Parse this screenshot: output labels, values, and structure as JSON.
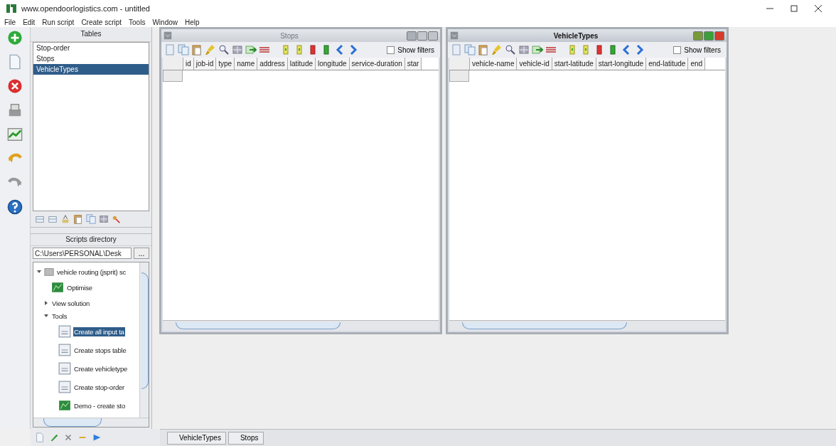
{
  "window": {
    "title": "www.opendoorlogistics.com - untitled"
  },
  "menu": [
    "File",
    "Edit",
    "Run script",
    "Create script",
    "Tools",
    "Window",
    "Help"
  ],
  "tables_panel": {
    "title": "Tables",
    "items": [
      {
        "label": "Stop-order",
        "selected": false
      },
      {
        "label": "Stops",
        "selected": false
      },
      {
        "label": "VehicleTypes",
        "selected": true
      }
    ]
  },
  "scripts_panel": {
    "title": "Scripts directory",
    "path": "C:\\Users\\PERSONAL\\Desk",
    "browse_button": "...",
    "tree": [
      {
        "label": "vehicle routing (jsprit) sc",
        "kind": "folder",
        "expanded": true,
        "selected": false,
        "children": [
          {
            "label": "Optimise",
            "kind": "script",
            "selected": false
          },
          {
            "label": "View solution",
            "kind": "group",
            "expanded": false,
            "selected": false
          },
          {
            "label": "Tools",
            "kind": "group",
            "expanded": true,
            "selected": false,
            "children": [
              {
                "label": "Create all input ta",
                "kind": "tool",
                "selected": true
              },
              {
                "label": "Create stops table",
                "kind": "tool",
                "selected": false
              },
              {
                "label": "Create vehicletype",
                "kind": "tool",
                "selected": false
              },
              {
                "label": "Create stop-order",
                "kind": "tool",
                "selected": false
              },
              {
                "label": "Demo - create sto",
                "kind": "script",
                "selected": false
              }
            ]
          }
        ]
      }
    ]
  },
  "windows": [
    {
      "title": "Stops",
      "active": false,
      "show_filters": {
        "label": "Show filters",
        "checked": false
      },
      "columns": [
        "id",
        "job-id",
        "type",
        "name",
        "address",
        "latitude",
        "longitude",
        "service-duration",
        "star"
      ]
    },
    {
      "title": "VehicleTypes",
      "active": true,
      "show_filters": {
        "label": "Show filters",
        "checked": false
      },
      "columns": [
        "vehicle-name",
        "vehicle-id",
        "start-latitude",
        "start-longitude",
        "end-latitude",
        "end"
      ]
    }
  ],
  "taskbar": [
    {
      "label": "VehicleTypes"
    },
    {
      "label": "Stops"
    }
  ]
}
